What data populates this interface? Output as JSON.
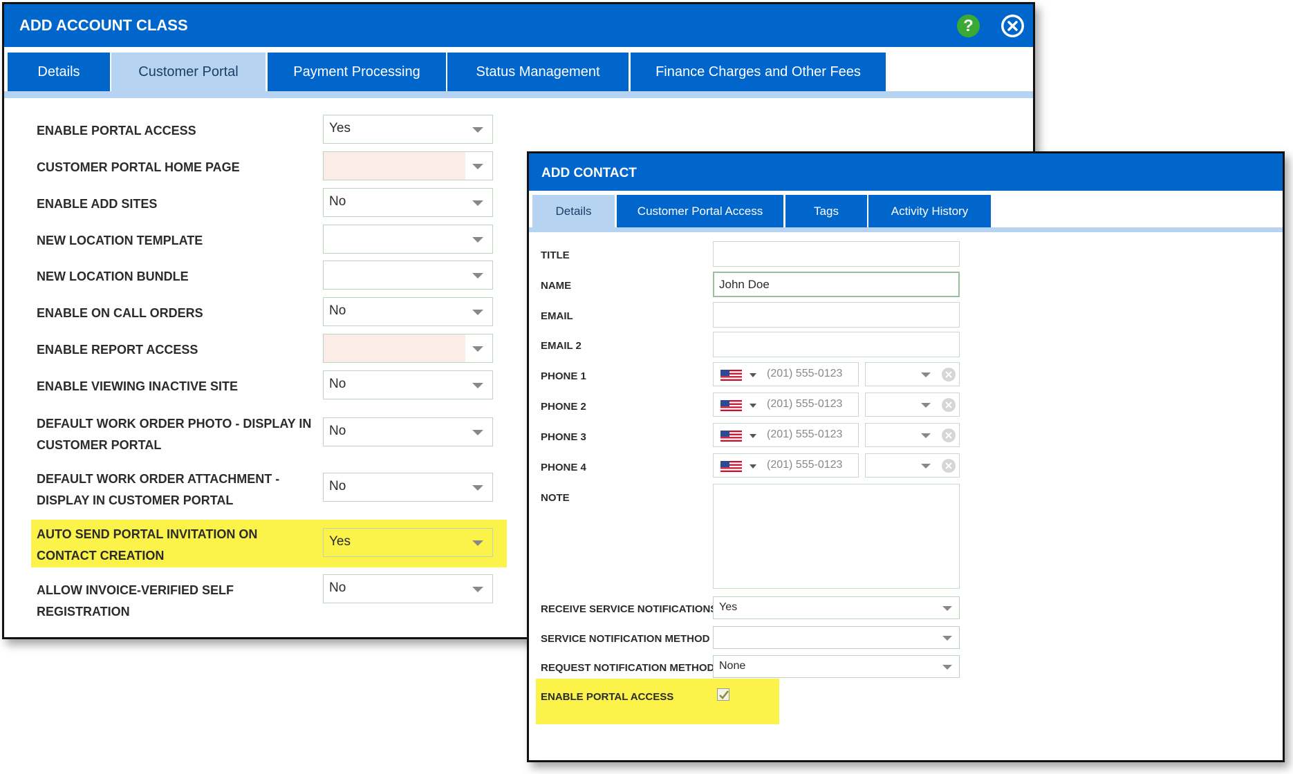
{
  "account_dialog": {
    "title": "ADD ACCOUNT CLASS",
    "help_icon": "question-mark",
    "tabs": [
      {
        "label": "Details",
        "active": false
      },
      {
        "label": "Customer Portal",
        "active": true
      },
      {
        "label": "Payment Processing",
        "active": false
      },
      {
        "label": "Status Management",
        "active": false
      },
      {
        "label": "Finance Charges and Other Fees",
        "active": false
      }
    ],
    "fields": [
      {
        "label": "ENABLE PORTAL ACCESS",
        "value": "Yes"
      },
      {
        "label": "CUSTOMER PORTAL HOME PAGE",
        "value": ""
      },
      {
        "label": "ENABLE ADD SITES",
        "value": "No"
      },
      {
        "label": "NEW LOCATION TEMPLATE",
        "value": ""
      },
      {
        "label": "NEW LOCATION BUNDLE",
        "value": ""
      },
      {
        "label": "ENABLE ON CALL ORDERS",
        "value": "No"
      },
      {
        "label": "ENABLE REPORT ACCESS",
        "value": ""
      },
      {
        "label": "ENABLE VIEWING INACTIVE SITE",
        "value": "No"
      },
      {
        "label": "DEFAULT WORK ORDER PHOTO - DISPLAY IN CUSTOMER PORTAL",
        "value": "No"
      },
      {
        "label": "DEFAULT WORK ORDER ATTACHMENT - DISPLAY IN CUSTOMER PORTAL",
        "value": "No"
      },
      {
        "label": "AUTO SEND PORTAL INVITATION ON CONTACT CREATION",
        "value": "Yes"
      },
      {
        "label": "ALLOW INVOICE-VERIFIED SELF REGISTRATION",
        "value": "No"
      }
    ]
  },
  "contact_dialog": {
    "title": "ADD CONTACT",
    "tabs": [
      {
        "label": "Details",
        "active": true
      },
      {
        "label": "Customer Portal Access",
        "active": false
      },
      {
        "label": "Tags",
        "active": false
      },
      {
        "label": "Activity History",
        "active": false
      }
    ],
    "fields": {
      "title": {
        "label": "TITLE",
        "value": ""
      },
      "name": {
        "label": "NAME",
        "value": "John Doe"
      },
      "email": {
        "label": "EMAIL",
        "value": ""
      },
      "email2": {
        "label": "EMAIL 2",
        "value": ""
      },
      "phones": [
        {
          "label": "PHONE 1",
          "placeholder": "(201) 555-0123"
        },
        {
          "label": "PHONE 2",
          "placeholder": "(201) 555-0123"
        },
        {
          "label": "PHONE 3",
          "placeholder": "(201) 555-0123"
        },
        {
          "label": "PHONE 4",
          "placeholder": "(201) 555-0123"
        }
      ],
      "note": {
        "label": "NOTE",
        "value": ""
      },
      "receive_service_notifications": {
        "label": "RECEIVE SERVICE NOTIFICATIONS",
        "value": "Yes"
      },
      "service_notification_method": {
        "label": "SERVICE NOTIFICATION METHOD",
        "value": ""
      },
      "request_notification_method": {
        "label": "REQUEST NOTIFICATION METHOD",
        "value": "None"
      },
      "enable_portal_access": {
        "label": "ENABLE PORTAL ACCESS",
        "checked": true
      }
    }
  },
  "colors": {
    "header_blue": "#0066cc",
    "active_tab": "#b6d4f2",
    "highlight_yellow": "#fbf34a",
    "help_green": "#3aaa35"
  }
}
